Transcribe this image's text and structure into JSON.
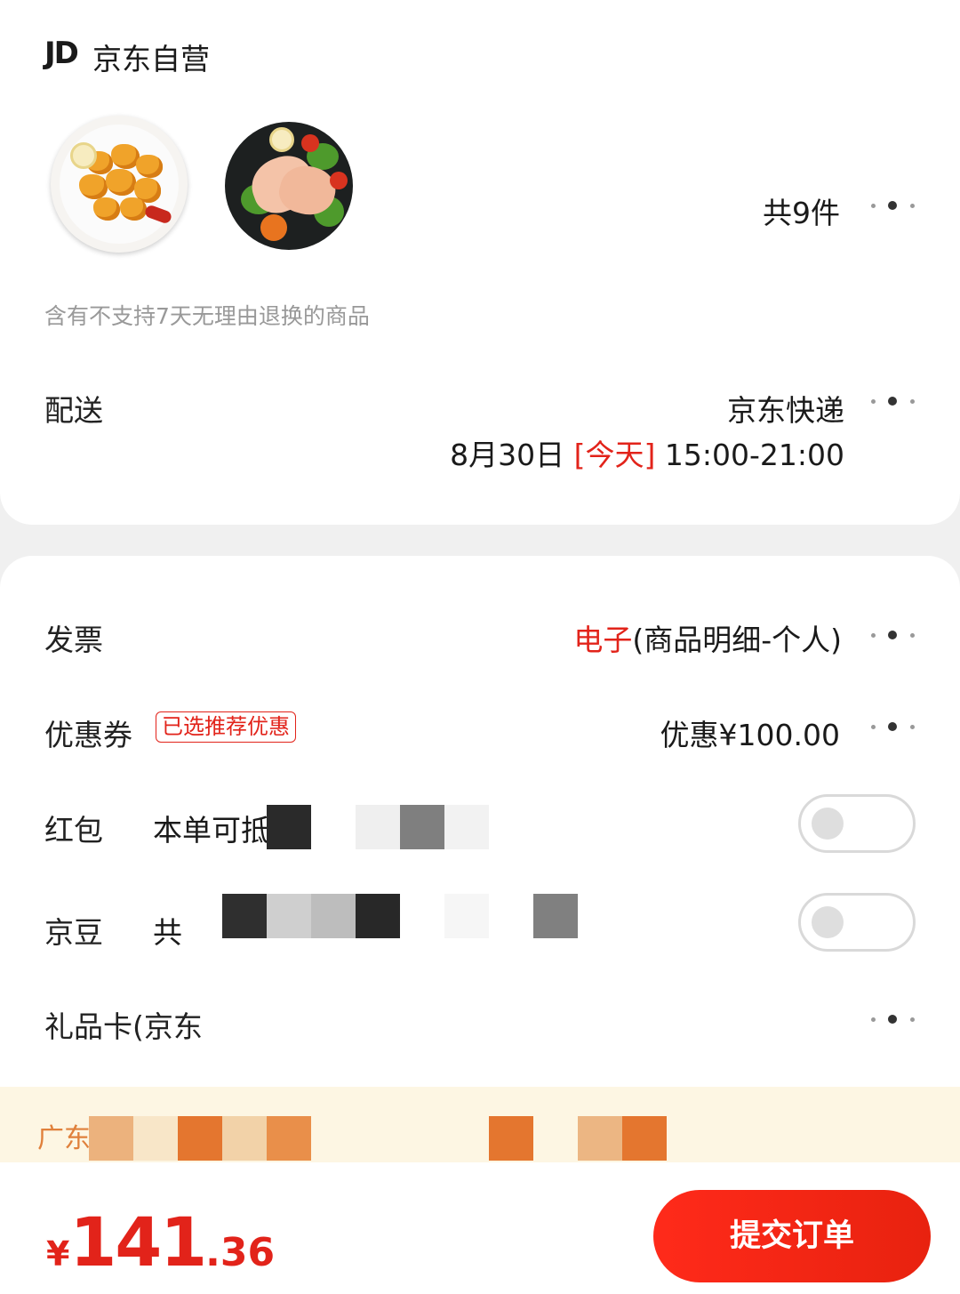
{
  "store": {
    "logo": "JD",
    "name": "京东自营"
  },
  "products": {
    "count_label": "共9件"
  },
  "notice": "含有不支持7天无理由退换的商品",
  "delivery": {
    "label": "配送",
    "courier": "京东快递",
    "date": "8月30日",
    "today": "[今天]",
    "time_window": "15:00-21:00"
  },
  "invoice": {
    "label": "发票",
    "type": "电子",
    "detail": "(商品明细-个人)"
  },
  "coupon": {
    "label": "优惠券",
    "tag": "已选推荐优惠",
    "value": "优惠¥100.00"
  },
  "red_packet": {
    "label": "红包",
    "text": "本单可抵",
    "enabled": false
  },
  "jd_beans": {
    "label": "京豆",
    "text": "共",
    "enabled": false
  },
  "gift_card": {
    "label": "礼品卡(京东"
  },
  "ad": {
    "text": "广东"
  },
  "footer": {
    "currency": "¥",
    "price_int": "141",
    "price_dec": ".36",
    "submit_label": "提交订单"
  },
  "colors": {
    "accent": "#e2231a",
    "ad_bg": "#fdf6e3"
  },
  "icons": [
    "more-dots-icon",
    "toggle-switch"
  ]
}
